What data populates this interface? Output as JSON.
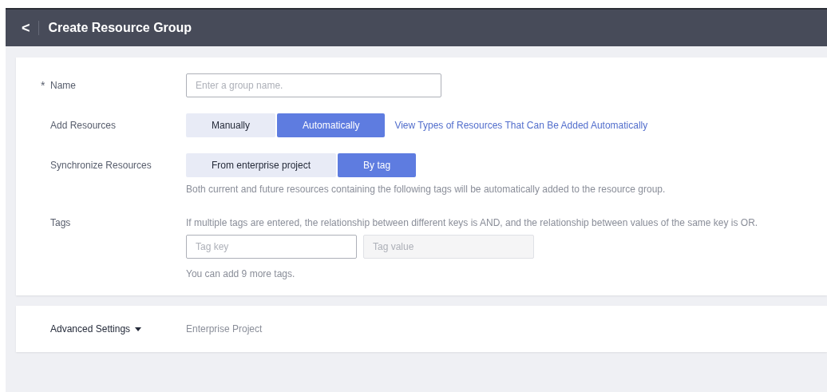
{
  "header": {
    "back": "<",
    "title": "Create Resource Group"
  },
  "form": {
    "name": {
      "label": "Name",
      "required_mark": "*",
      "placeholder": "Enter a group name."
    },
    "add_resources": {
      "label": "Add Resources",
      "options": [
        {
          "label": "Manually",
          "selected": false
        },
        {
          "label": "Automatically",
          "selected": true
        }
      ],
      "link": "View Types of Resources That Can Be Added Automatically"
    },
    "synchronize_resources": {
      "label": "Synchronize Resources",
      "options": [
        {
          "label": "From enterprise project",
          "selected": false
        },
        {
          "label": "By tag",
          "selected": true
        }
      ],
      "hint": "Both current and future resources containing the following tags will be automatically added to the resource group."
    },
    "tags": {
      "label": "Tags",
      "hint": "If multiple tags are entered, the relationship between different keys is AND, and the relationship between values of the same key is OR.",
      "key": {
        "placeholder": "Tag key",
        "disabled": false
      },
      "value": {
        "placeholder": "Tag value",
        "disabled": true
      },
      "note": "You can add 9 more tags."
    }
  },
  "advanced": {
    "label": "Advanced Settings",
    "expanded": false,
    "field": "Enterprise Project"
  }
}
